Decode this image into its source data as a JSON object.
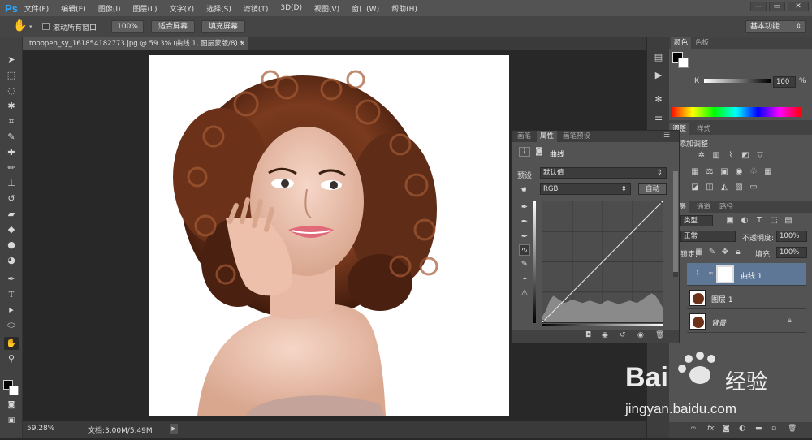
{
  "app": {
    "logo": "Ps"
  },
  "menu": {
    "items": [
      "文件(F)",
      "编辑(E)",
      "图像(I)",
      "图层(L)",
      "文字(Y)",
      "选择(S)",
      "滤镜(T)",
      "3D(D)",
      "视图(V)",
      "窗口(W)",
      "帮助(H)"
    ]
  },
  "window_controls": {
    "minimize": "—",
    "restore": "▭",
    "close": "✕"
  },
  "options": {
    "scroll_all_label": "滚动所有窗口",
    "zoom_100_label": "100%",
    "fit_screen_label": "适合屏幕",
    "fill_screen_label": "填充屏幕",
    "workspace": "基本功能"
  },
  "document": {
    "tab_title": "tooopen_sy_161854182773.jpg @ 59.3% (曲线 1, 图层蒙版/8) *",
    "tab_close": "×"
  },
  "status": {
    "zoom": "59.28%",
    "doc_info": "文档:3.00M/5.49M",
    "arrow": "▶"
  },
  "color_panel": {
    "tabs": [
      "颜色",
      "色板"
    ],
    "channel_label": "K",
    "k_value": "100",
    "percent": "%"
  },
  "adjustments_panel": {
    "tabs": [
      "调整",
      "样式"
    ],
    "title": "添加调整"
  },
  "layers_panel": {
    "tabs": [
      "图层",
      "通道",
      "路径"
    ],
    "kind_filter": "类型",
    "blend_mode": "正常",
    "opacity_label": "不透明度:",
    "opacity_value": "100%",
    "lock_label": "锁定:",
    "fill_label": "填充:",
    "fill_value": "100%",
    "layers": [
      {
        "name": "曲线 1",
        "type": "adjustment",
        "selected": true
      },
      {
        "name": "图层 1",
        "type": "image",
        "selected": false
      },
      {
        "name": "背景",
        "type": "background",
        "selected": false
      }
    ],
    "footer_fx": "fx"
  },
  "properties_panel": {
    "tabs": [
      "画笔",
      "属性",
      "画笔预设"
    ],
    "title": "曲线",
    "preset_label": "预设:",
    "preset_value": "默认值",
    "channel_value": "RGB",
    "auto_label": "自动"
  },
  "curve": {
    "input_points": [
      0,
      255
    ],
    "output_points": [
      0,
      255
    ],
    "axis_max": 255
  },
  "histogram": [
    0.05,
    0.1,
    0.18,
    0.22,
    0.2,
    0.18,
    0.16,
    0.17,
    0.19,
    0.18,
    0.17,
    0.16,
    0.17,
    0.18,
    0.17,
    0.16,
    0.15,
    0.17,
    0.18,
    0.17,
    0.16,
    0.15,
    0.16,
    0.17,
    0.18,
    0.17,
    0.16,
    0.18,
    0.2,
    0.22,
    0.24,
    0.22,
    0.18,
    0.12
  ],
  "watermark": {
    "brand_latin": "Bai",
    "brand_cn": "经验",
    "url": "jingyan.baidu.com"
  },
  "colors": {
    "accent": "#31a8ff",
    "chrome": "#535353",
    "canvas_bg": "#282828"
  }
}
